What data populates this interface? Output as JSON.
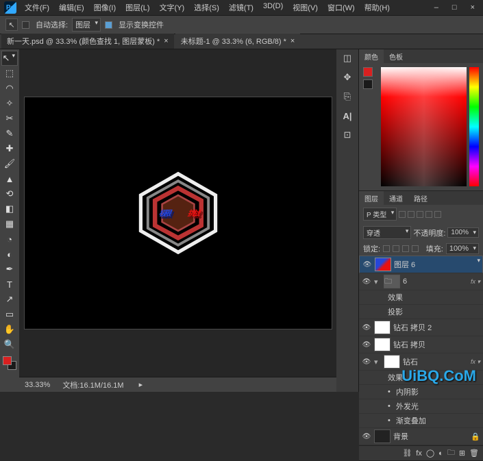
{
  "menu": {
    "file": "文件(F)",
    "edit": "编辑(E)",
    "image": "图像(I)",
    "layer": "图层(L)",
    "type": "文字(Y)",
    "select": "选择(S)",
    "filter": "滤镜(T)",
    "3d": "3D(D)",
    "view": "视图(V)",
    "window": "窗口(W)",
    "help": "帮助(H)"
  },
  "win": {
    "min": "–",
    "max": "□",
    "close": "×"
  },
  "options": {
    "autoSelect": "自动选择:",
    "autoSelectTarget": "图层",
    "showTransform": "显示变换控件"
  },
  "tabs": [
    {
      "label": "新一天.psd @ 33.3% (颜色查找 1, 图层蒙板) *"
    },
    {
      "label": "未标题-1 @ 33.3% (6, RGB/8) *",
      "active": true
    }
  ],
  "color": {
    "tab1": "颜色",
    "tab2": "色板",
    "fg": "#d92020",
    "bg": "#1a1a1a"
  },
  "layersPanel": {
    "tab1": "图层",
    "tab2": "通道",
    "tab3": "路径",
    "kind": "P 类型",
    "blend": "穿透",
    "opacityLabel": "不透明度:",
    "opacity": "100%",
    "lockLabel": "锁定:",
    "fillLabel": "填充:",
    "fill": "100%"
  },
  "layers": [
    {
      "vis": true,
      "name": "图层 6",
      "thumb": "link",
      "sel": true
    },
    {
      "vis": true,
      "name": "6",
      "thumb": "folder",
      "fx": true,
      "open": true
    },
    {
      "sub": true,
      "name": "效果"
    },
    {
      "sub": true,
      "name": "投影"
    },
    {
      "vis": true,
      "name": "钻石 拷贝 2",
      "thumb": "w"
    },
    {
      "vis": true,
      "name": "钻石 拷贝",
      "thumb": "w"
    },
    {
      "vis": true,
      "name": "钻石",
      "thumb": "w",
      "fx": true,
      "open": true
    },
    {
      "sub": true,
      "name": "效果"
    },
    {
      "sub": true,
      "bullet": true,
      "name": "内阴影"
    },
    {
      "sub": true,
      "bullet": true,
      "name": "外发光"
    },
    {
      "sub": true,
      "bullet": true,
      "name": "渐变叠加"
    },
    {
      "vis": true,
      "name": "背景",
      "thumb": "black",
      "lock": true
    }
  ],
  "layerFoot": {
    "link": "⛓",
    "fx": "fx",
    "mask": "◯",
    "adj": "◐",
    "group": "🗀",
    "new": "⊞",
    "del": "🗑"
  },
  "status": {
    "zoom": "33.33%",
    "info": "文档:16.1M/16.1M"
  },
  "sideIcons": [
    "⊞",
    "✥",
    "⎘",
    "T",
    "A|",
    "⊡"
  ],
  "tools": [
    "↖",
    "⬚",
    "▭",
    "✂",
    "✎",
    "⟲",
    "✐",
    "⌫",
    "◐",
    "✚",
    "▢",
    "✎",
    "✎",
    "△",
    "✋",
    "T",
    "↖",
    "⊡",
    "✋",
    "🔍"
  ],
  "art": {
    "left": "极限",
    "right": "挑战"
  },
  "watermark": "UiBQ.CoM"
}
